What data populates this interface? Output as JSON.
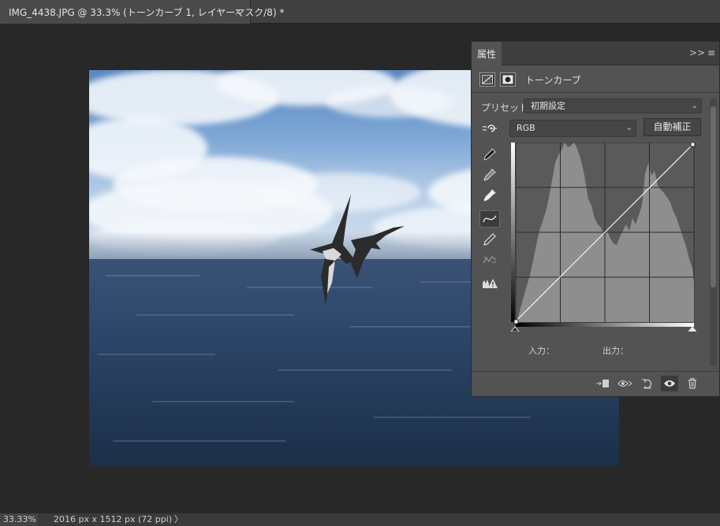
{
  "document": {
    "tab_title": "IMG_4438.JPG @ 33.3% (トーンカーブ 1, レイヤーマスク/8) *",
    "close_glyph": "×"
  },
  "panel": {
    "tab_label": "属性",
    "collapse_glyph": ">>",
    "menu_glyph": "≡",
    "adjustment_title": "トーンカーブ",
    "preset_label": "プリセット：",
    "preset_value": "初期設定",
    "channel_value": "RGB",
    "auto_button": "自動補正",
    "input_label": "入力：",
    "output_label": "出力：",
    "icons": {
      "adjustment": "curves-grid-icon",
      "mask": "layer-mask-icon",
      "on_image": "on-image-adjust-icon",
      "black_point": "black-eyedropper-icon",
      "gray_point": "gray-eyedropper-icon",
      "white_point": "white-eyedropper-icon",
      "edit_points": "curve-points-icon",
      "draw": "pencil-icon",
      "smooth": "smooth-curve-icon",
      "clipping": "clipping-warning-icon",
      "clip_to_layer": "clip-to-layer-icon",
      "view_previous": "view-previous-icon",
      "reset": "reset-icon",
      "visibility": "eye-icon",
      "delete": "trash-icon"
    }
  },
  "status": {
    "zoom": "33.33%",
    "doc_size": "2016 px x 1512 px (72 ppi)",
    "arrow": "〉"
  },
  "colors": {
    "panel_bg": "#535353",
    "workspace_bg": "#282828",
    "curve_line": "#ffffff",
    "histogram": "#8e8e8e"
  }
}
